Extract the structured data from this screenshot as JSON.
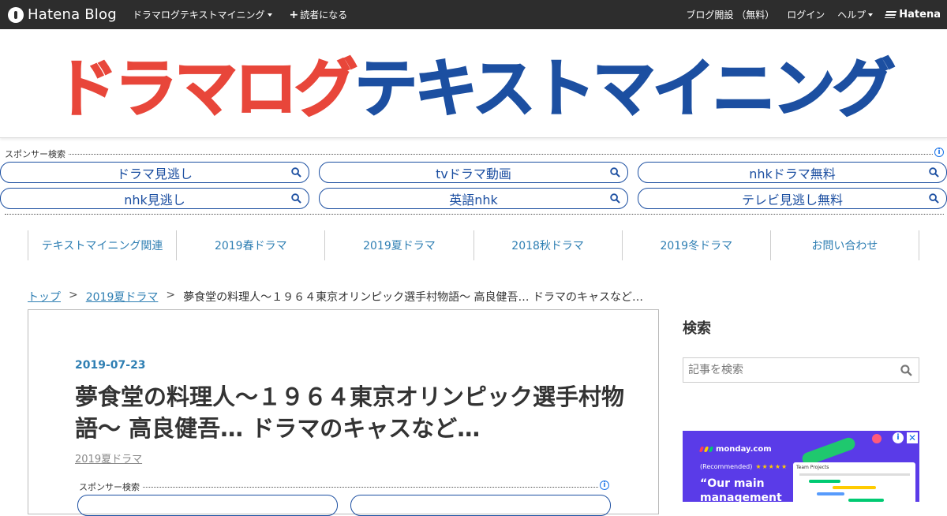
{
  "topbar": {
    "logo_text": "Hatena Blog",
    "blog_menu": "ドラマログテキストマイニング",
    "subscribe": "読者になる",
    "open_blog": "ブログ開設 （無料）",
    "login": "ログイン",
    "help": "ヘルプ",
    "hatena": "Hatena"
  },
  "header": {
    "title_part1": "ドラマログ",
    "title_part2": "テキストマイニング"
  },
  "sponsor": {
    "label": "スポンサー検索",
    "info": "i",
    "items": [
      "ドラマ見逃し",
      "tvドラマ動画",
      "nhkドラマ無料",
      "nhk見逃し",
      "英語nhk",
      "テレビ見逃し無料"
    ]
  },
  "nav": {
    "categories": [
      "テキストマイニング関連",
      "2019春ドラマ",
      "2019夏ドラマ",
      "2018秋ドラマ",
      "2019冬ドラマ",
      "お問い合わせ"
    ]
  },
  "breadcrumb": {
    "top": "トップ",
    "sep": ">",
    "category": "2019夏ドラマ",
    "current": "夢食堂の料理人～１９６４東京オリンピック選手村物語～ 高良健吾… ドラマのキャスなど…"
  },
  "article": {
    "date": "2019-07-23",
    "title": "夢食堂の料理人～１９６４東京オリンピック選手村物語～ 高良健吾… ドラマのキャスなど…",
    "category": "2019夏ドラマ",
    "sponsor_label": "スポンサー検索"
  },
  "sidebar": {
    "search_heading": "検索",
    "search_placeholder": "記事を検索"
  },
  "ad": {
    "brand": "monday.com",
    "recommended": "(Recommended)",
    "stars": "★★★★★",
    "quote": "“Our main management tool",
    "panel_title": "Team Projects",
    "colors": {
      "bg": "#5a3be8",
      "green": "#1fc86e",
      "pink": "#ff5a7a",
      "yellow": "#ffcb00"
    }
  },
  "colors": {
    "topbar": "#2d2d2d",
    "link": "#2f7fb3",
    "title_red": "#e8463a",
    "title_blue": "#1c4fa1"
  }
}
